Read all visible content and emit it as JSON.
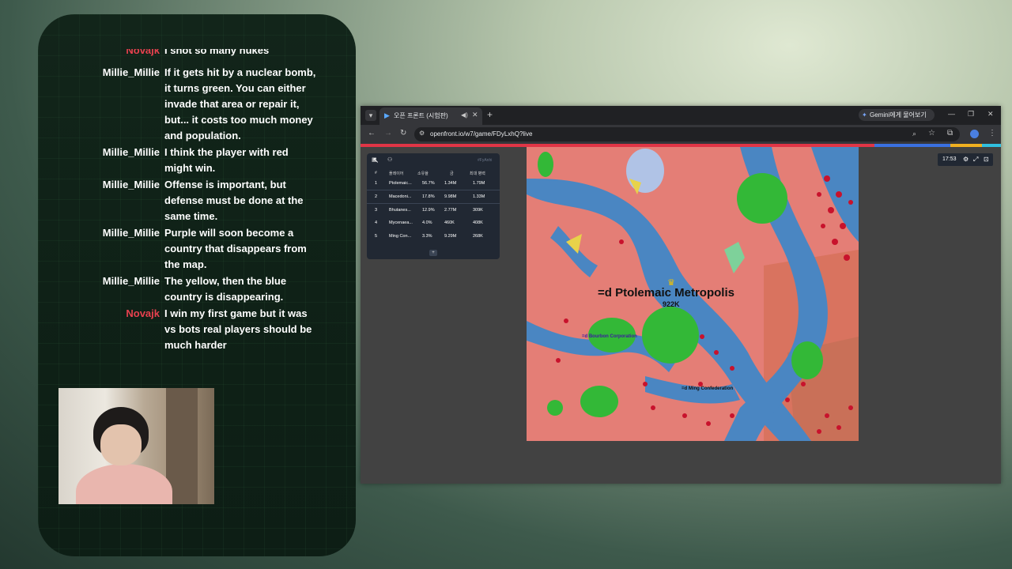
{
  "chat": {
    "messages": [
      {
        "user": "Novajk",
        "text": "I shot so many nukes"
      },
      {
        "user": "Millie_Millie",
        "text": "If it gets hit by a nuclear bomb, it turns green. You can either invade that area or repair it, but... it costs too much money and population."
      },
      {
        "user": "Millie_Millie",
        "text": "I think the player with red might win."
      },
      {
        "user": "Millie_Millie",
        "text": "Offense is important, but defense must be done at the same time."
      },
      {
        "user": "Millie_Millie",
        "text": "Purple will soon become a country that disappears from the map."
      },
      {
        "user": "Millie_Millie",
        "text": "The yellow, then the blue country is disappearing."
      },
      {
        "user": "Novajk",
        "text": "I win my first game but it was vs bots real players should be much harder"
      }
    ],
    "colors": {
      "novajk": "#e8414f",
      "millie": "#ffffff"
    }
  },
  "browser": {
    "tab_title": "오픈 프론트 (시험판)",
    "gemini_label": "Gemini에게 물어보기",
    "url": "openfront.io/w7/game/FDyLxhQ?live",
    "accent": "#e03546"
  },
  "game": {
    "timer": "17:53",
    "leaderboard": {
      "watermark": "#FyAnhi",
      "headers": {
        "rank": "#",
        "player": "플레이어",
        "owned": "소유율",
        "gold": "금",
        "max_troops": "최대 병력"
      },
      "rows": [
        {
          "rank": "1",
          "name": "Ptolemaic...",
          "owned": "56.7%",
          "gold": "1.34M",
          "troops": "1.79M"
        },
        {
          "rank": "2",
          "name": "Macedoni...",
          "owned": "17.8%",
          "gold": "9.98M",
          "troops": "1.33M"
        },
        {
          "rank": "3",
          "name": "Bhutanes...",
          "owned": "12.9%",
          "gold": "2.77M",
          "troops": "309K"
        },
        {
          "rank": "4",
          "name": "Mycenaea...",
          "owned": "4.0%",
          "gold": "460K",
          "troops": "408K"
        },
        {
          "rank": "5",
          "name": "Ming Con...",
          "owned": "3.3%",
          "gold": "9.29M",
          "troops": "268K"
        }
      ],
      "more": "+"
    },
    "map": {
      "main_city_label": "=d Ptolemaic Metropolis",
      "main_city_pop": "922K",
      "label_bourbon": "=d Bourbon Corporation",
      "label_ming": "=d Ming Confederation"
    }
  }
}
